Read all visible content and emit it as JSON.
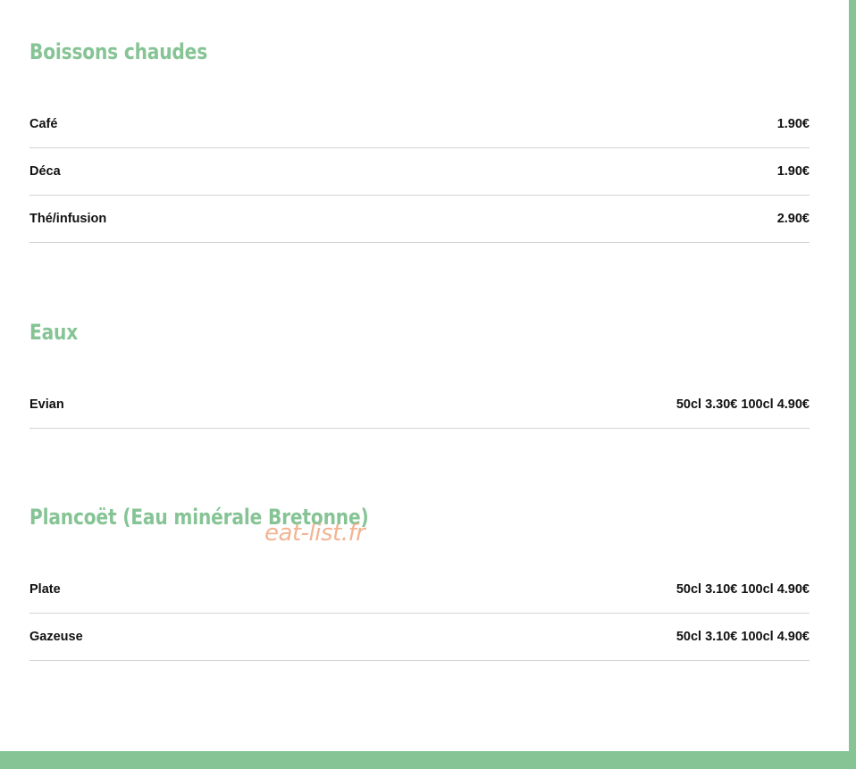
{
  "sections": [
    {
      "title": "Boissons chaudes",
      "items": [
        {
          "name": "Café",
          "price": "1.90€"
        },
        {
          "name": "Déca",
          "price": "1.90€"
        },
        {
          "name": "Thé/infusion",
          "price": "2.90€"
        }
      ]
    },
    {
      "title": "Eaux",
      "items": [
        {
          "name": "Evian",
          "price": "50cl 3.30€ 100cl 4.90€"
        }
      ]
    },
    {
      "title": "Plancoët (Eau minérale Bretonne)",
      "items": [
        {
          "name": "Plate",
          "price": "50cl 3.10€ 100cl 4.90€"
        },
        {
          "name": "Gazeuse",
          "price": "50cl 3.10€ 100cl 4.90€"
        }
      ]
    }
  ],
  "watermark": "eat-list.fr",
  "colors": {
    "accent": "#86c495",
    "watermark": "#f0a77f",
    "divider": "#d4d4d4"
  }
}
